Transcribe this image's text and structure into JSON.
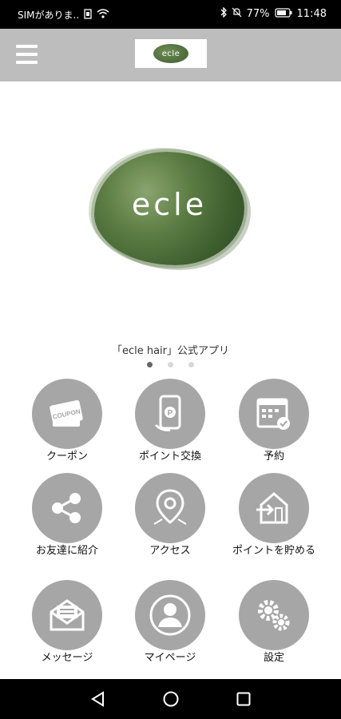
{
  "status_bar": {
    "carrier": "SIMがありま..",
    "battery": "77%",
    "time": "11:48"
  },
  "header": {
    "logo_text": "ecle"
  },
  "hero": {
    "logo_text": "ecle"
  },
  "caption": "「ecle hair」公式アプリ",
  "carousel": {
    "pages": 3,
    "active": 1
  },
  "menu": [
    {
      "label": "クーポン",
      "icon": "coupon-icon"
    },
    {
      "label": "ポイント交換",
      "icon": "point-card-icon"
    },
    {
      "label": "予約",
      "icon": "calendar-icon"
    },
    {
      "label": "お友達に紹介",
      "icon": "share-icon"
    },
    {
      "label": "アクセス",
      "icon": "map-pin-icon"
    },
    {
      "label": "ポイントを貯める",
      "icon": "checkin-icon"
    },
    {
      "label": "メッセージ",
      "icon": "mail-icon"
    },
    {
      "label": "マイページ",
      "icon": "person-icon"
    },
    {
      "label": "設定",
      "icon": "gears-icon"
    }
  ],
  "colors": {
    "header_bg": "#bdbdbd",
    "tile_circle": "#a6a6a6",
    "brand_green": "#4f6f3a"
  }
}
